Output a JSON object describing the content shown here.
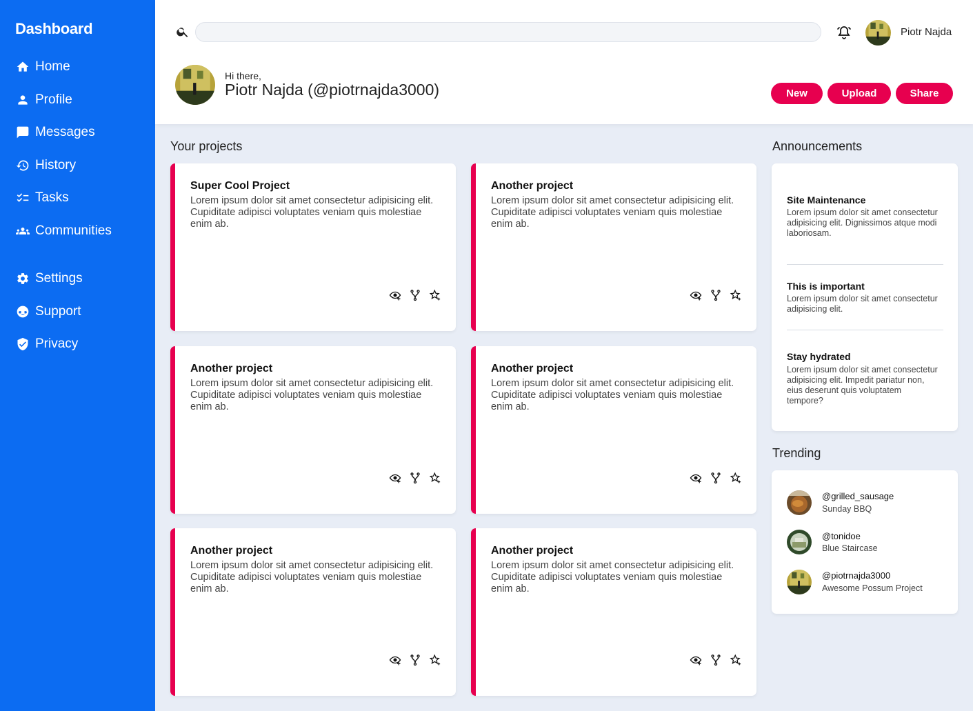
{
  "sidebar": {
    "brand": "Dashboard",
    "items": [
      {
        "label": "Home",
        "icon": "home-icon"
      },
      {
        "label": "Profile",
        "icon": "user-icon"
      },
      {
        "label": "Messages",
        "icon": "chat-icon"
      },
      {
        "label": "History",
        "icon": "history-icon"
      },
      {
        "label": "Tasks",
        "icon": "tasks-icon"
      },
      {
        "label": "Communities",
        "icon": "people-icon"
      },
      {
        "label": "Settings",
        "icon": "gear-icon"
      },
      {
        "label": "Support",
        "icon": "support-icon"
      },
      {
        "label": "Privacy",
        "icon": "shield-icon"
      }
    ]
  },
  "header": {
    "search_placeholder": "",
    "user_name": "Piotr Najda",
    "greeting": "Hi there,",
    "full_name": "Piotr Najda (@piotrnajda3000)",
    "buttons": {
      "new": "New",
      "upload": "Upload",
      "share": "Share"
    }
  },
  "projects": {
    "title": "Your projects",
    "items": [
      {
        "title": "Super Cool Project",
        "desc": "Lorem ipsum dolor sit amet consectetur adipisicing elit. Cupiditate adipisci voluptates veniam quis molestiae enim ab."
      },
      {
        "title": "Another project",
        "desc": "Lorem ipsum dolor sit amet consectetur adipisicing elit. Cupiditate adipisci voluptates veniam quis molestiae enim ab."
      },
      {
        "title": "Another project",
        "desc": "Lorem ipsum dolor sit amet consectetur adipisicing elit. Cupiditate adipisci voluptates veniam quis molestiae enim ab."
      },
      {
        "title": "Another project",
        "desc": "Lorem ipsum dolor sit amet consectetur adipisicing elit. Cupiditate adipisci voluptates veniam quis molestiae enim ab."
      },
      {
        "title": "Another project",
        "desc": "Lorem ipsum dolor sit amet consectetur adipisicing elit. Cupiditate adipisci voluptates veniam quis molestiae enim ab."
      },
      {
        "title": "Another project",
        "desc": "Lorem ipsum dolor sit amet consectetur adipisicing elit. Cupiditate adipisci voluptates veniam quis molestiae enim ab."
      }
    ]
  },
  "announcements": {
    "title": "Announcements",
    "items": [
      {
        "title": "Site Maintenance",
        "text": "Lorem ipsum dolor sit amet consectetur adipisicing elit. Dignissimos atque modi laboriosam."
      },
      {
        "title": "This is important",
        "text": "Lorem ipsum dolor sit amet consectetur adipisicing elit."
      },
      {
        "title": "Stay hydrated",
        "text": "Lorem ipsum dolor sit amet consectetur adipisicing elit. Impedit pariatur non, eius deserunt quis voluptatem tempore?"
      }
    ]
  },
  "trending": {
    "title": "Trending",
    "items": [
      {
        "handle": "@grilled_sausage",
        "sub": "Sunday BBQ"
      },
      {
        "handle": "@tonidoe",
        "sub": "Blue Staircase"
      },
      {
        "handle": "@piotrnajda3000",
        "sub": "Awesome Possum Project"
      }
    ]
  },
  "colors": {
    "sidebar": "#0c6cf2",
    "accent": "#e7004f",
    "background": "#e8edf6"
  }
}
